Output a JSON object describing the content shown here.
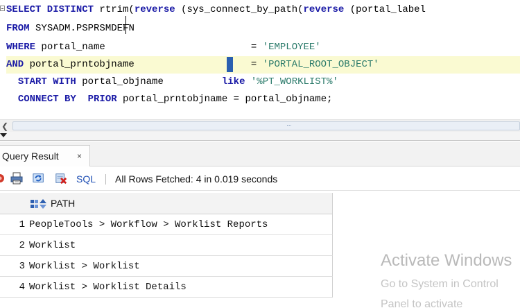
{
  "editor": {
    "lines": [
      [
        [
          "kw",
          "SELECT DISTINCT "
        ],
        [
          "",
          "rtrim("
        ],
        [
          "kw",
          "reverse "
        ],
        [
          "",
          "(sys_connect_by_path("
        ],
        [
          "kw",
          "reverse "
        ],
        [
          "",
          "(portal_label"
        ]
      ],
      [
        [
          "kw",
          "FROM "
        ],
        [
          "",
          "SYSADM.PSPRSMDEFN"
        ]
      ],
      [
        [
          "kw",
          "WHERE "
        ],
        [
          "",
          "portal_name                         = "
        ],
        [
          "str",
          "'EMPLOYEE'"
        ]
      ],
      [
        [
          "kw",
          "AND "
        ],
        [
          "",
          "portal_prntobjname                    = "
        ],
        [
          "str",
          "'PORTAL_ROOT_OBJECT'"
        ]
      ],
      [
        [
          "",
          "  "
        ],
        [
          "kw",
          "START WITH "
        ],
        [
          "",
          "portal_objname          "
        ],
        [
          "kw",
          "like "
        ],
        [
          "str",
          "'%PT_WORKLIST%'"
        ]
      ],
      [
        [
          "",
          "  "
        ],
        [
          "kw",
          "CONNECT BY  PRIOR "
        ],
        [
          "",
          "portal_prntobjname = portal_objname;"
        ]
      ]
    ]
  },
  "results": {
    "tab_label": "Query Result",
    "tab_close": "×",
    "toolbar": {
      "icons": [
        "pin-icon",
        "print-icon",
        "refresh-icon",
        "delete-icon"
      ],
      "sql_label": "SQL",
      "status": "All Rows Fetched: 4 in 0.019 seconds"
    },
    "column_header": "PATH",
    "rows": [
      {
        "num": "1",
        "path": "PeopleTools > Workflow > Worklist Reports"
      },
      {
        "num": "2",
        "path": "Worklist"
      },
      {
        "num": "3",
        "path": "Worklist > Worklist"
      },
      {
        "num": "4",
        "path": "Worklist > Worklist Details"
      }
    ]
  },
  "watermark": {
    "title": "Activate Windows",
    "subtitle": "Go to System in Control",
    "subtitle2": "Panel to activate"
  },
  "colors": {
    "keyword": "#1a1aa6",
    "string": "#2a7a6a",
    "highlight_line": "#fafad2",
    "sql_link": "#1f4fb4"
  }
}
